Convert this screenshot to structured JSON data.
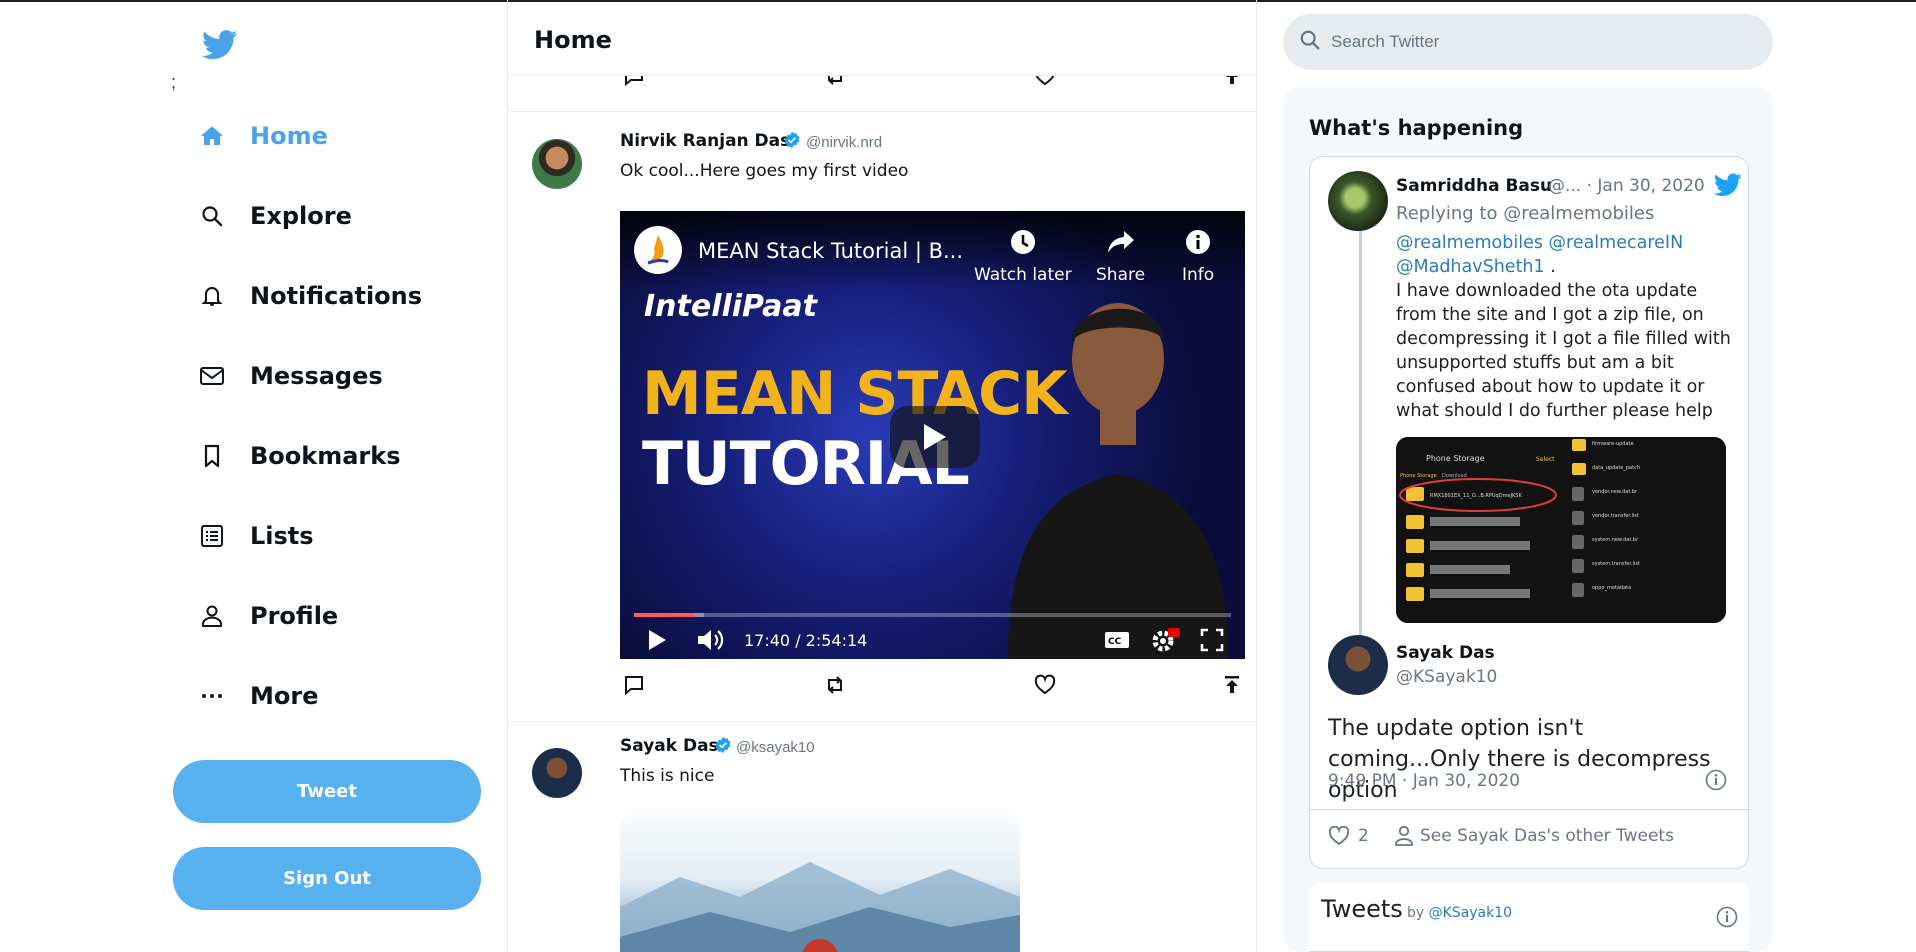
{
  "colors": {
    "accent": "#4aa3e8",
    "button": "#56b1ee",
    "verified": "#1da1f2",
    "border": "#e6ecf0"
  },
  "sidebar": {
    "logo": "twitter-bird-icon",
    "stray_text": ";",
    "items": [
      {
        "label": "Home",
        "icon": "home-icon",
        "active": true
      },
      {
        "label": "Explore",
        "icon": "search-icon"
      },
      {
        "label": "Notifications",
        "icon": "bell-icon"
      },
      {
        "label": "Messages",
        "icon": "envelope-icon"
      },
      {
        "label": "Bookmarks",
        "icon": "bookmark-icon"
      },
      {
        "label": "Lists",
        "icon": "list-icon"
      },
      {
        "label": "Profile",
        "icon": "person-icon"
      },
      {
        "label": "More",
        "icon": "more-icon"
      }
    ],
    "tweet_button": "Tweet",
    "signout_button": "Sign Out"
  },
  "main": {
    "title": "Home",
    "tweets": [
      {
        "name": "Nirvik Ranjan Das",
        "handle": "@nirvik.nrd",
        "text": "Ok cool...Here goes my first video",
        "video": {
          "title": "MEAN Stack Tutorial | B...",
          "watch_later": "Watch later",
          "share": "Share",
          "info": "Info",
          "brand": "IntelliPaat",
          "headline1": "MEAN STACK",
          "headline2": "TUTORIAL",
          "time": "17:40 / 2:54:14",
          "progress": 0.1016
        }
      },
      {
        "name": "Sayak Das",
        "handle": "@ksayak10",
        "text": "This is nice"
      }
    ]
  },
  "right": {
    "search_placeholder": "Search Twitter",
    "happening_title": "What's happening",
    "embed": {
      "author": "Samriddha Basu",
      "author_rest": "@... · Jan 30, 2020",
      "replying": "Replying to @realmemobiles",
      "mentions": "@realmemobiles @realmecareIN @MadhavSheth1",
      "mentions_tail": " .",
      "body": "I have downloaded the ota update from the site and I got a zip file, on decompressing it I got a file filled with unsupported stuffs but am a bit confused about how to update it or what should I do further please help",
      "reply_name": "Sayak Das",
      "reply_handle": "@KSayak10",
      "reply_text": "The update option isn't coming...Only there is decompress option",
      "reply_time": "9:49 PM · Jan 30, 2020",
      "likes": "2",
      "see_more": "See Sayak Das's other Tweets",
      "screenshot": {
        "header": "Phone Storage",
        "select": "Select",
        "crumb1": "Phone Storage",
        "crumb2": "Download",
        "file1": "RMX1801EX_11_O...B.RPUqDmeJKSK",
        "right_files": [
          "firmware-update",
          "data_update_patch",
          "vendor.new.dat.br",
          "vendor.transfer.list",
          "system.new.dat.br",
          "system.transfer.list",
          "oppo_metadata"
        ]
      }
    },
    "tweets_bar": {
      "label": "Tweets",
      "by": "by",
      "handle": "@KSayak10"
    }
  }
}
